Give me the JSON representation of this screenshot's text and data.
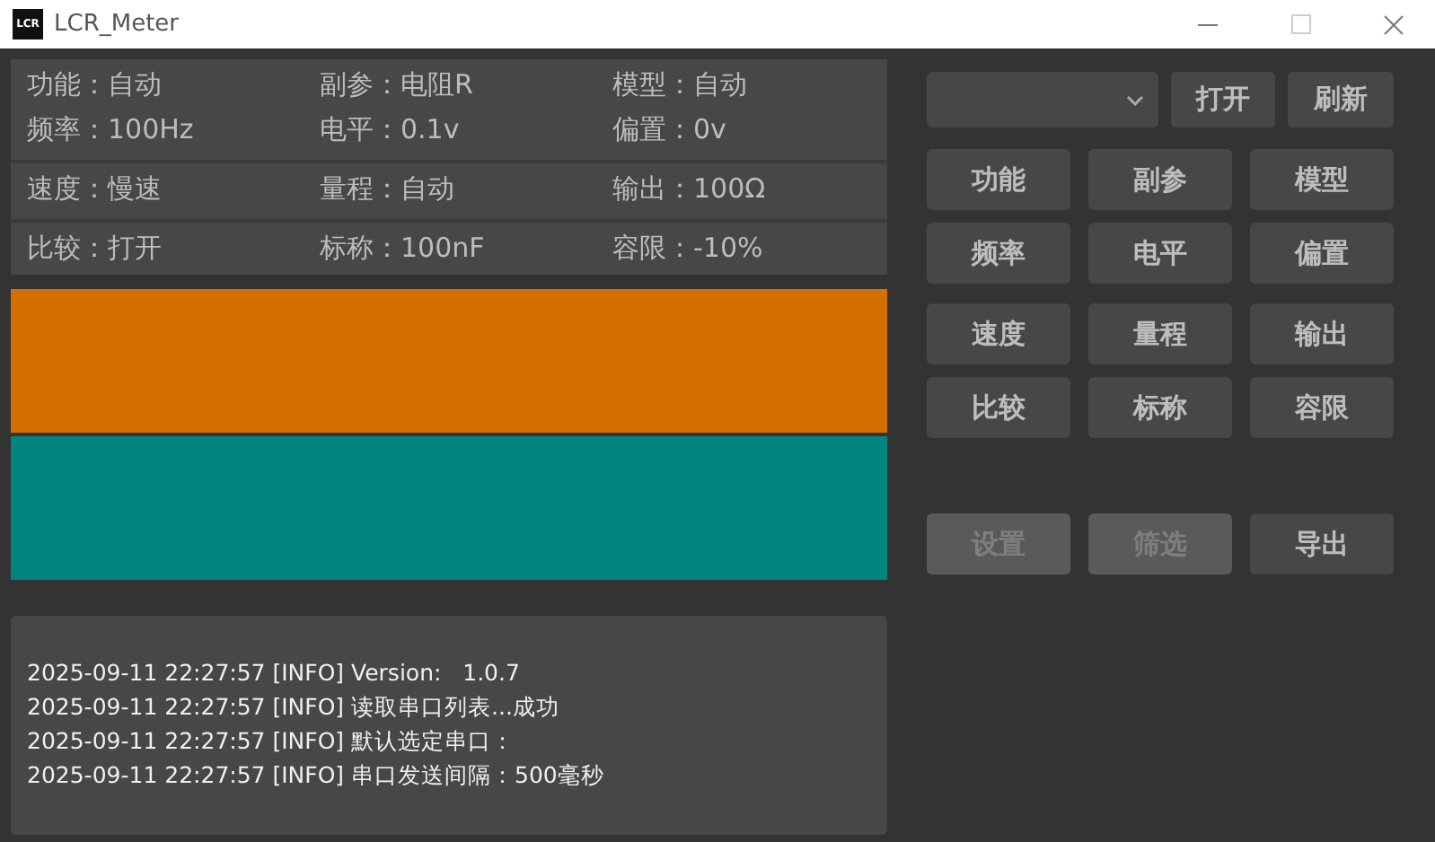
{
  "window": {
    "title": "LCR_Meter",
    "logo": "LCR"
  },
  "info_groups": [
    [
      [
        {
          "label": "功能：",
          "value": "自动"
        },
        {
          "label": "副参：",
          "value": "电阻R"
        },
        {
          "label": "模型：",
          "value": "自动"
        }
      ],
      [
        {
          "label": "频率：",
          "value": "100Hz"
        },
        {
          "label": "电平：",
          "value": "0.1v"
        },
        {
          "label": "偏置：",
          "value": "0v"
        }
      ]
    ],
    [
      [
        {
          "label": "速度：",
          "value": "慢速"
        },
        {
          "label": "量程：",
          "value": "自动"
        },
        {
          "label": "输出：",
          "value": "100Ω"
        }
      ]
    ],
    [
      [
        {
          "label": "比较：",
          "value": "打开"
        },
        {
          "label": "标称：",
          "value": "100nF"
        },
        {
          "label": "容限：",
          "value": "-10%"
        }
      ]
    ]
  ],
  "display_bars": [
    {
      "color": "#d47000"
    },
    {
      "color": "#00857f"
    }
  ],
  "log": [
    "2025-09-11 22:27:57 [INFO] Version:   1.0.7",
    "2025-09-11 22:27:57 [INFO] 读取串口列表...成功",
    "2025-09-11 22:27:57 [INFO] 默认选定串口：",
    "2025-09-11 22:27:57 [INFO] 串口发送间隔：500毫秒"
  ],
  "port_buttons": [
    {
      "label": "打开"
    },
    {
      "label": "刷新"
    }
  ],
  "button_rows": [
    [
      {
        "label": "功能",
        "disabled": false
      },
      {
        "label": "副参",
        "disabled": false
      },
      {
        "label": "模型",
        "disabled": false
      }
    ],
    [
      {
        "label": "频率",
        "disabled": false
      },
      {
        "label": "电平",
        "disabled": false
      },
      {
        "label": "偏置",
        "disabled": false
      }
    ],
    [
      {
        "label": "速度",
        "disabled": false
      },
      {
        "label": "量程",
        "disabled": false
      },
      {
        "label": "输出",
        "disabled": false
      }
    ],
    [
      {
        "label": "比较",
        "disabled": false
      },
      {
        "label": "标称",
        "disabled": false
      },
      {
        "label": "容限",
        "disabled": false
      }
    ]
  ],
  "bottom_buttons": [
    {
      "label": "设置",
      "disabled": true
    },
    {
      "label": "筛选",
      "disabled": true
    },
    {
      "label": "导出",
      "disabled": false
    }
  ]
}
